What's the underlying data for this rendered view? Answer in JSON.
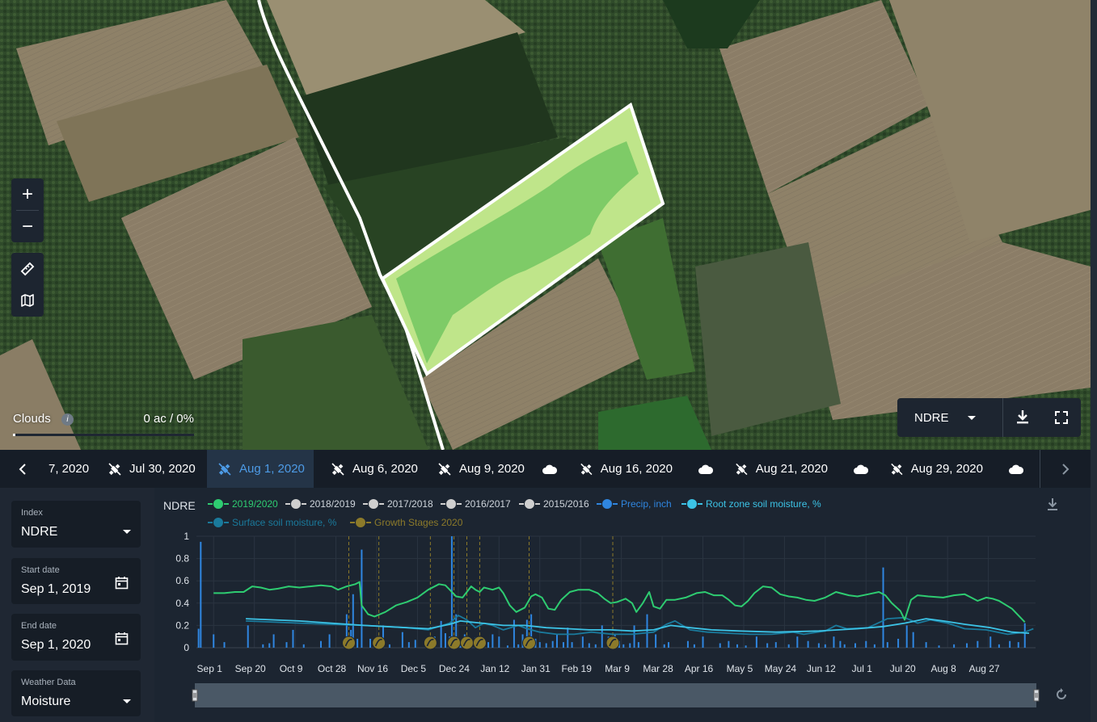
{
  "map": {
    "zoom_in_label": "+",
    "zoom_out_label": "−",
    "clouds": {
      "label": "Clouds",
      "info": "i",
      "value": "0 ac / 0%",
      "slider_fraction": 0.0
    },
    "index_select": {
      "value": "NDRE"
    },
    "icons": {
      "ruler": "ruler-icon",
      "map": "map-layers-icon",
      "download": "download-icon",
      "fullscreen": "fullscreen-icon"
    }
  },
  "date_strip": {
    "items": [
      {
        "label": "7, 2020",
        "type": "satellite",
        "active": false
      },
      {
        "label": "Jul 30, 2020",
        "type": "satellite",
        "active": false
      },
      {
        "label": "Aug 1, 2020",
        "type": "satellite",
        "active": true
      },
      {
        "label": "Aug 6, 2020",
        "type": "satellite",
        "active": false
      },
      {
        "label": "Aug 9, 2020",
        "type": "satellite",
        "active": false
      },
      {
        "label": "",
        "type": "cloud",
        "active": false
      },
      {
        "label": "Aug 16, 2020",
        "type": "satellite",
        "active": false
      },
      {
        "label": "",
        "type": "cloud",
        "active": false
      },
      {
        "label": "Aug 21, 2020",
        "type": "satellite",
        "active": false
      },
      {
        "label": "",
        "type": "cloud",
        "active": false
      },
      {
        "label": "Aug 29, 2020",
        "type": "satellite",
        "active": false
      },
      {
        "label": "",
        "type": "cloud",
        "active": false
      }
    ]
  },
  "sidebar": {
    "index": {
      "label": "Index",
      "value": "NDRE"
    },
    "start_date": {
      "label": "Start date",
      "value": "Sep 1, 2019"
    },
    "end_date": {
      "label": "End date",
      "value": "Sep 1, 2020"
    },
    "weather": {
      "label": "Weather Data",
      "value": "Moisture"
    }
  },
  "chart": {
    "title": "NDRE",
    "legend": [
      {
        "label": "2019/2020",
        "color": "#2ecc71",
        "text_color": "#2ecc71"
      },
      {
        "label": "2018/2019",
        "color": "#cfcfcf",
        "text_color": "#cfd5dc"
      },
      {
        "label": "2017/2018",
        "color": "#cfcfcf",
        "text_color": "#cfd5dc"
      },
      {
        "label": "2016/2017",
        "color": "#cfcfcf",
        "text_color": "#cfd5dc"
      },
      {
        "label": "2015/2016",
        "color": "#cfcfcf",
        "text_color": "#cfd5dc"
      },
      {
        "label": "Precip, inch",
        "color": "#2f86e0",
        "text_color": "#2f86e0"
      },
      {
        "label": "Root zone soil moisture, %",
        "color": "#3cc3e6",
        "text_color": "#3cc3e6"
      },
      {
        "label": "Surface soil moisture, %",
        "color": "#1a7a9c",
        "text_color": "#1a7a9c"
      },
      {
        "label": "Growth Stages 2020",
        "color": "#8c7a2a",
        "text_color": "#8c7a2a"
      }
    ]
  },
  "chart_data": {
    "type": "line",
    "ylim": [
      0,
      1
    ],
    "yticks": [
      "0",
      "0.2",
      "0.4",
      "0.6",
      "0.8",
      "1"
    ],
    "xticks": [
      "Sep 1",
      "Sep 20",
      "Oct 9",
      "Oct 28",
      "Nov 16",
      "Dec 5",
      "Dec 24",
      "Jan 12",
      "Jan 31",
      "Feb 19",
      "Mar 9",
      "Mar 28",
      "Apr 16",
      "May 5",
      "May 24",
      "Jun 12",
      "Jul 1",
      "Jul 20",
      "Aug 8",
      "Aug 27"
    ],
    "x_range_days": [
      0,
      366
    ],
    "series": [
      {
        "name": "2019/2020",
        "color": "#2ecc71",
        "points": [
          [
            0,
            0.49
          ],
          [
            5,
            0.49
          ],
          [
            10,
            0.5
          ],
          [
            14,
            0.5
          ],
          [
            18,
            0.55
          ],
          [
            22,
            0.54
          ],
          [
            26,
            0.52
          ],
          [
            30,
            0.53
          ],
          [
            35,
            0.55
          ],
          [
            40,
            0.54
          ],
          [
            45,
            0.55
          ],
          [
            50,
            0.56
          ],
          [
            55,
            0.55
          ],
          [
            58,
            0.52
          ],
          [
            62,
            0.55
          ],
          [
            66,
            0.57
          ],
          [
            68,
            0.59
          ],
          [
            69,
            0.38
          ],
          [
            72,
            0.3
          ],
          [
            75,
            0.28
          ],
          [
            80,
            0.32
          ],
          [
            85,
            0.38
          ],
          [
            90,
            0.41
          ],
          [
            95,
            0.45
          ],
          [
            100,
            0.52
          ],
          [
            105,
            0.57
          ],
          [
            108,
            0.56
          ],
          [
            110,
            0.52
          ],
          [
            113,
            0.46
          ],
          [
            116,
            0.45
          ],
          [
            118,
            0.5
          ],
          [
            120,
            0.55
          ],
          [
            122,
            0.52
          ],
          [
            124,
            0.5
          ],
          [
            126,
            0.54
          ],
          [
            130,
            0.52
          ],
          [
            133,
            0.54
          ],
          [
            135,
            0.49
          ],
          [
            138,
            0.38
          ],
          [
            141,
            0.32
          ],
          [
            145,
            0.36
          ],
          [
            148,
            0.46
          ],
          [
            150,
            0.48
          ],
          [
            153,
            0.45
          ],
          [
            156,
            0.35
          ],
          [
            159,
            0.34
          ],
          [
            162,
            0.43
          ],
          [
            166,
            0.5
          ],
          [
            170,
            0.52
          ],
          [
            175,
            0.52
          ],
          [
            179,
            0.49
          ],
          [
            182,
            0.44
          ],
          [
            185,
            0.4
          ],
          [
            188,
            0.41
          ],
          [
            192,
            0.44
          ],
          [
            195,
            0.4
          ],
          [
            197,
            0.32
          ],
          [
            200,
            0.4
          ],
          [
            203,
            0.5
          ],
          [
            205,
            0.37
          ],
          [
            208,
            0.35
          ],
          [
            211,
            0.43
          ],
          [
            215,
            0.43
          ],
          [
            220,
            0.45
          ],
          [
            225,
            0.49
          ],
          [
            229,
            0.5
          ],
          [
            233,
            0.47
          ],
          [
            237,
            0.47
          ],
          [
            240,
            0.43
          ],
          [
            243,
            0.38
          ],
          [
            246,
            0.37
          ],
          [
            249,
            0.42
          ],
          [
            252,
            0.49
          ],
          [
            256,
            0.55
          ],
          [
            260,
            0.54
          ],
          [
            264,
            0.48
          ],
          [
            268,
            0.46
          ],
          [
            272,
            0.45
          ],
          [
            276,
            0.43
          ],
          [
            280,
            0.42
          ],
          [
            285,
            0.45
          ],
          [
            290,
            0.5
          ],
          [
            296,
            0.47
          ],
          [
            300,
            0.46
          ],
          [
            305,
            0.48
          ],
          [
            310,
            0.5
          ],
          [
            313,
            0.47
          ],
          [
            316,
            0.4
          ],
          [
            320,
            0.33
          ],
          [
            322,
            0.25
          ],
          [
            325,
            0.43
          ],
          [
            328,
            0.47
          ],
          [
            333,
            0.46
          ],
          [
            340,
            0.45
          ],
          [
            345,
            0.47
          ],
          [
            350,
            0.48
          ],
          [
            353,
            0.45
          ],
          [
            356,
            0.42
          ],
          [
            360,
            0.45
          ],
          [
            363,
            0.44
          ],
          [
            366,
            0.42
          ],
          [
            372,
            0.35
          ],
          [
            378,
            0.23
          ]
        ]
      },
      {
        "name": "Root zone soil moisture, %",
        "color": "#3cc3e6",
        "points": [
          [
            15,
            0.26
          ],
          [
            40,
            0.24
          ],
          [
            70,
            0.2
          ],
          [
            90,
            0.18
          ],
          [
            100,
            0.17
          ],
          [
            110,
            0.21
          ],
          [
            115,
            0.24
          ],
          [
            120,
            0.23
          ],
          [
            125,
            0.22
          ],
          [
            135,
            0.2
          ],
          [
            145,
            0.2
          ],
          [
            155,
            0.18
          ],
          [
            165,
            0.17
          ],
          [
            175,
            0.16
          ],
          [
            185,
            0.16
          ],
          [
            195,
            0.15
          ],
          [
            205,
            0.16
          ],
          [
            213,
            0.2
          ],
          [
            222,
            0.18
          ],
          [
            232,
            0.16
          ],
          [
            245,
            0.15
          ],
          [
            262,
            0.14
          ],
          [
            282,
            0.15
          ],
          [
            300,
            0.17
          ],
          [
            312,
            0.19
          ],
          [
            322,
            0.22
          ],
          [
            332,
            0.26
          ],
          [
            340,
            0.24
          ],
          [
            350,
            0.21
          ],
          [
            362,
            0.18
          ],
          [
            372,
            0.14
          ],
          [
            380,
            0.13
          ]
        ]
      },
      {
        "name": "Surface soil moisture, %",
        "color": "#1a7a9c",
        "points": [
          [
            15,
            0.24
          ],
          [
            40,
            0.22
          ],
          [
            70,
            0.2
          ],
          [
            90,
            0.18
          ],
          [
            100,
            0.16
          ],
          [
            110,
            0.22
          ],
          [
            114,
            0.29
          ],
          [
            118,
            0.25
          ],
          [
            122,
            0.18
          ],
          [
            126,
            0.22
          ],
          [
            130,
            0.2
          ],
          [
            135,
            0.16
          ],
          [
            142,
            0.2
          ],
          [
            146,
            0.17
          ],
          [
            152,
            0.14
          ],
          [
            160,
            0.12
          ],
          [
            168,
            0.12
          ],
          [
            176,
            0.14
          ],
          [
            186,
            0.12
          ],
          [
            195,
            0.12
          ],
          [
            205,
            0.14
          ],
          [
            211,
            0.21
          ],
          [
            215,
            0.24
          ],
          [
            222,
            0.16
          ],
          [
            230,
            0.14
          ],
          [
            240,
            0.13
          ],
          [
            250,
            0.12
          ],
          [
            260,
            0.12
          ],
          [
            270,
            0.14
          ],
          [
            275,
            0.12
          ],
          [
            285,
            0.15
          ],
          [
            290,
            0.2
          ],
          [
            295,
            0.17
          ],
          [
            305,
            0.18
          ],
          [
            314,
            0.26
          ],
          [
            322,
            0.27
          ],
          [
            328,
            0.22
          ],
          [
            334,
            0.25
          ],
          [
            342,
            0.22
          ],
          [
            350,
            0.17
          ],
          [
            360,
            0.16
          ],
          [
            370,
            0.12
          ],
          [
            378,
            0.14
          ],
          [
            382,
            0.17
          ]
        ]
      }
    ],
    "precip_bars": [
      [
        -7,
        0.17
      ],
      [
        -6,
        0.95
      ],
      [
        0,
        0.12
      ],
      [
        5,
        0.05
      ],
      [
        16,
        0.2
      ],
      [
        23,
        0.03
      ],
      [
        26,
        0.04
      ],
      [
        28,
        0.12
      ],
      [
        34,
        0.05
      ],
      [
        37,
        0.16
      ],
      [
        42,
        0.03
      ],
      [
        50,
        0.06
      ],
      [
        54,
        0.12
      ],
      [
        62,
        0.3
      ],
      [
        64,
        0.16
      ],
      [
        65,
        0.48
      ],
      [
        67,
        0.08
      ],
      [
        69,
        0.88
      ],
      [
        73,
        0.08
      ],
      [
        76,
        0.1
      ],
      [
        79,
        0.2
      ],
      [
        82,
        0.03
      ],
      [
        88,
        0.14
      ],
      [
        91,
        0.05
      ],
      [
        94,
        0.07
      ],
      [
        100,
        0.05
      ],
      [
        103,
        0.1
      ],
      [
        106,
        0.24
      ],
      [
        108,
        0.13
      ],
      [
        110,
        0.1
      ],
      [
        111,
        1.0
      ],
      [
        113,
        0.3
      ],
      [
        115,
        0.05
      ],
      [
        117,
        0.12
      ],
      [
        119,
        0.06
      ],
      [
        122,
        0.09
      ],
      [
        125,
        0.06
      ],
      [
        128,
        0.05
      ],
      [
        130,
        0.12
      ],
      [
        133,
        0.1
      ],
      [
        137,
        0.02
      ],
      [
        140,
        0.25
      ],
      [
        142,
        0.03
      ],
      [
        144,
        0.12
      ],
      [
        146,
        0.25
      ],
      [
        148,
        0.3
      ],
      [
        150,
        0.08
      ],
      [
        152,
        0.05
      ],
      [
        155,
        0.04
      ],
      [
        158,
        0.06
      ],
      [
        160,
        0.12
      ],
      [
        163,
        0.05
      ],
      [
        165,
        0.18
      ],
      [
        167,
        0.05
      ],
      [
        172,
        0.1
      ],
      [
        175,
        0.04
      ],
      [
        178,
        0.03
      ],
      [
        181,
        0.2
      ],
      [
        184,
        0.1
      ],
      [
        187,
        0.12
      ],
      [
        189,
        0.06
      ],
      [
        191,
        0.03
      ],
      [
        194,
        0.04
      ],
      [
        196,
        0.2
      ],
      [
        198,
        0.05
      ],
      [
        202,
        0.3
      ],
      [
        206,
        0.12
      ],
      [
        210,
        0.03
      ],
      [
        212,
        0.05
      ],
      [
        221,
        0.06
      ],
      [
        224,
        0.03
      ],
      [
        228,
        0.1
      ],
      [
        236,
        0.04
      ],
      [
        240,
        0.06
      ],
      [
        244,
        0.03
      ],
      [
        248,
        0.02
      ],
      [
        253,
        0.1
      ],
      [
        258,
        0.04
      ],
      [
        262,
        0.05
      ],
      [
        268,
        0.03
      ],
      [
        272,
        0.1
      ],
      [
        277,
        0.06
      ],
      [
        282,
        0.04
      ],
      [
        285,
        0.03
      ],
      [
        289,
        0.1
      ],
      [
        292,
        0.06
      ],
      [
        294,
        0.03
      ],
      [
        299,
        0.04
      ],
      [
        304,
        0.06
      ],
      [
        308,
        0.03
      ],
      [
        312,
        0.72
      ],
      [
        314,
        0.05
      ],
      [
        319,
        0.08
      ],
      [
        323,
        0.2
      ],
      [
        326,
        0.14
      ],
      [
        332,
        0.05
      ],
      [
        338,
        0.02
      ],
      [
        345,
        0.03
      ],
      [
        351,
        0.04
      ],
      [
        356,
        0.06
      ],
      [
        362,
        0.1
      ],
      [
        366,
        0.03
      ],
      [
        371,
        0.06
      ],
      [
        375,
        0.05
      ],
      [
        378,
        0.22
      ]
    ],
    "growth_stages": [
      63,
      77,
      101,
      112,
      118,
      124,
      147,
      186
    ]
  }
}
